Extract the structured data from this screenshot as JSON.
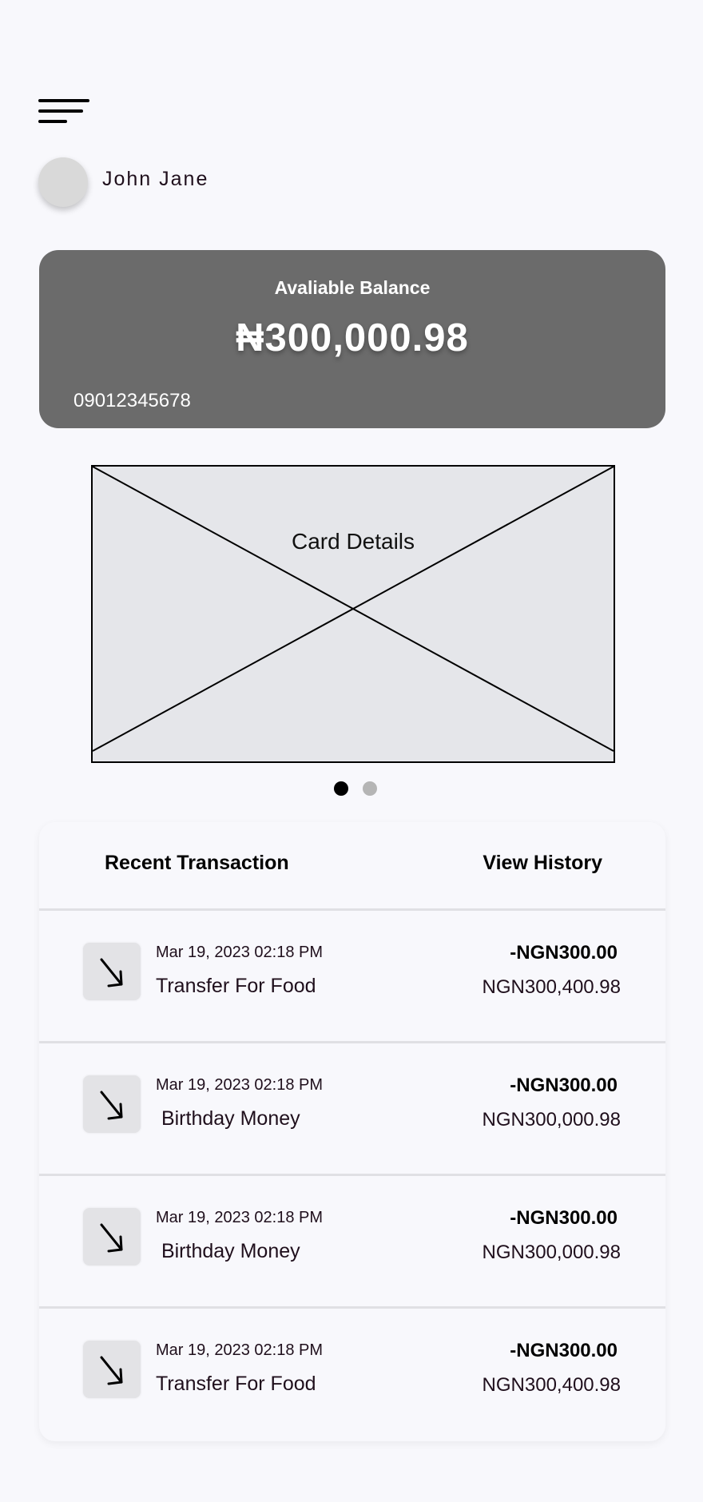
{
  "header": {
    "menu_icon": "hamburger-menu-icon"
  },
  "user": {
    "name": "John Jane",
    "avatar_icon": "avatar-placeholder"
  },
  "balance": {
    "label": "Avaliable Balance",
    "amount": "₦300,000.98",
    "account_number": "09012345678"
  },
  "card": {
    "label": "Card Details",
    "slide_count": 2,
    "active_slide": 1
  },
  "transactions": {
    "title": "Recent Transaction",
    "view_history": "View History",
    "items": [
      {
        "date": "Mar 19, 2023 02:18 PM",
        "description": "Transfer For Food",
        "amount": "-NGN300.00",
        "balance": "NGN300,400.98",
        "icon": "arrow-down-right-icon"
      },
      {
        "date": "Mar 19, 2023 02:18 PM",
        "description": " Birthday Money",
        "amount": "-NGN300.00",
        "balance": "NGN300,000.98",
        "icon": "arrow-down-right-icon"
      },
      {
        "date": "Mar 19, 2023 02:18 PM",
        "description": " Birthday Money",
        "amount": "-NGN300.00",
        "balance": "NGN300,000.98",
        "icon": "arrow-down-right-icon"
      },
      {
        "date": "Mar 19, 2023 02:18 PM",
        "description": "Transfer For Food",
        "amount": "-NGN300.00",
        "balance": "NGN300,400.98",
        "icon": "arrow-down-right-icon"
      }
    ]
  },
  "colors": {
    "background": "#f8f8fc",
    "balance_card": "#6b6b6b",
    "placeholder": "#e5e6ea",
    "text_dark": "#1f0f1c"
  }
}
